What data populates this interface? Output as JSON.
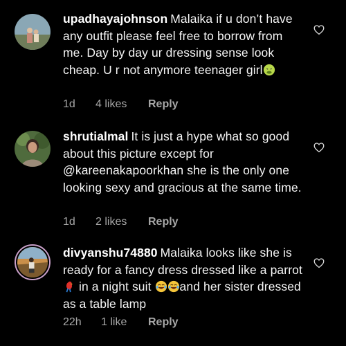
{
  "comments": [
    {
      "username": "upadhayajohnson",
      "text": "Malaika if u don’t have any outfit please feel free to borrow from me. Day by day ur dressing sense look cheap. U r not anymore teenager girl",
      "time": "1d",
      "likes": "4 likes",
      "reply": "Reply"
    },
    {
      "username": "shrutialmal",
      "text": "It is just a hype what so good about this picture except for @kareenakapoorkhan  she is the only one looking sexy and gracious at the same time.",
      "time": "1d",
      "likes": "2 likes",
      "reply": "Reply"
    },
    {
      "username": "divyanshu74880",
      "text_part1": "Malaika looks like she is ready for a fancy dress dressed like a parrot ",
      "text_part2": " in a night suit ",
      "text_part3": "and her sister dressed as a table lamp",
      "time": "22h",
      "likes": "1 like",
      "reply": "Reply"
    }
  ],
  "icons": {
    "heart": "heart-outline-icon",
    "sick_emoji": "nauseated-face-emoji",
    "parrot_emoji": "parrot-emoji",
    "laugh_emoji": "tears-of-joy-emoji"
  },
  "colors": {
    "background": "#000000",
    "meta": "#a8a8a8",
    "text": "#f5f5f5"
  }
}
